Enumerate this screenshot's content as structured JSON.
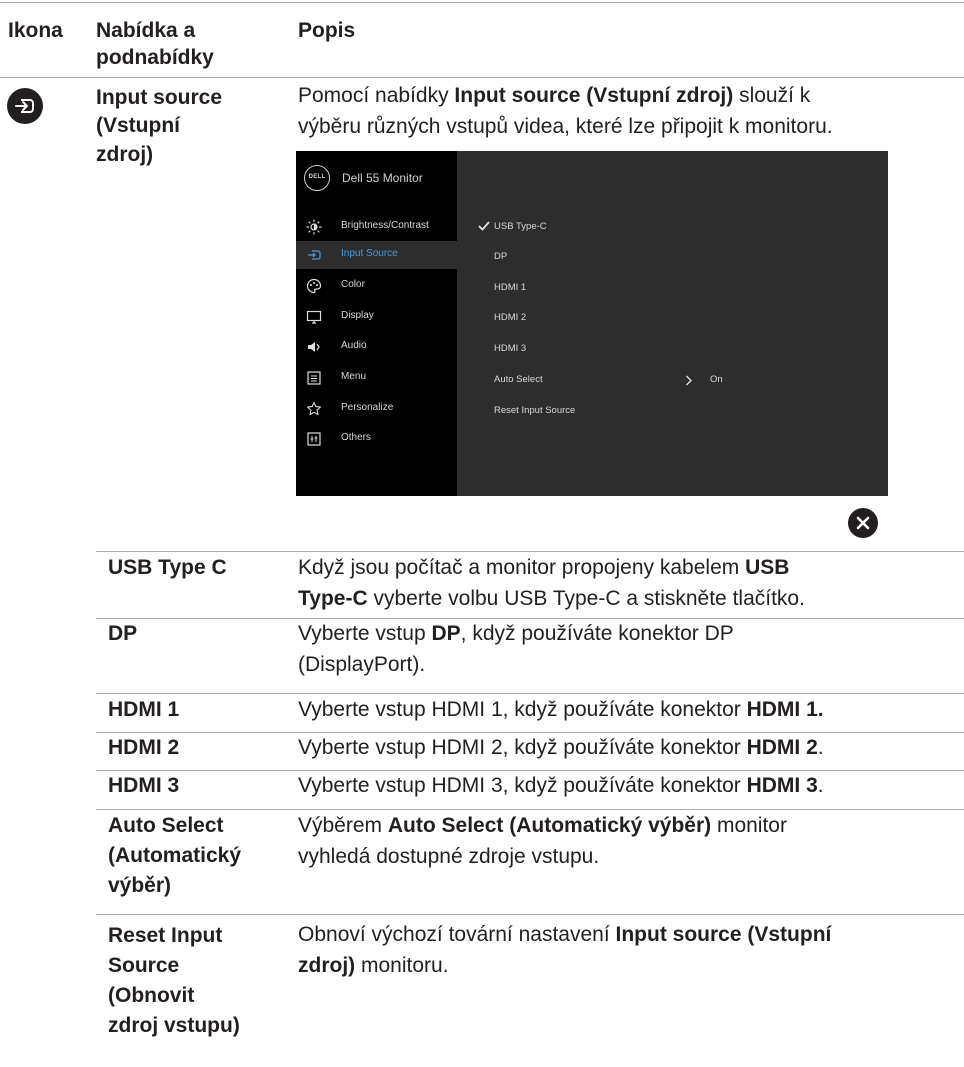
{
  "header": {
    "col_icon": "Ikona",
    "col_menu_line1": "Nabídka a",
    "col_menu_line2": "podnabídky",
    "col_desc": "Popis"
  },
  "main_row": {
    "icon": "input-source-icon",
    "label_lines": [
      "Input source",
      "(Vstupní",
      "zdroj)"
    ],
    "desc_line1_pre": "Pomocí nabídky ",
    "desc_line1_bold": "Input source (Vstupní zdroj)",
    "desc_line1_post": " slouží k",
    "desc_line2": "výběru různých vstupů videa, které lze připojit k monitoru."
  },
  "osd": {
    "logo_text": "DELL",
    "title": "Dell 55 Monitor",
    "menu": [
      {
        "label": "Brightness/Contrast",
        "icon": "brightness-icon"
      },
      {
        "label": "Input Source",
        "icon": "input-source-icon",
        "selected": true
      },
      {
        "label": "Color",
        "icon": "color-palette-icon"
      },
      {
        "label": "Display",
        "icon": "display-icon"
      },
      {
        "label": "Audio",
        "icon": "speaker-icon"
      },
      {
        "label": "Menu",
        "icon": "menu-icon"
      },
      {
        "label": "Personalize",
        "icon": "star-icon"
      },
      {
        "label": "Others",
        "icon": "others-icon"
      }
    ],
    "options": [
      {
        "label": "USB Type-C",
        "checked": true
      },
      {
        "label": "DP"
      },
      {
        "label": "HDMI 1"
      },
      {
        "label": "HDMI 2"
      },
      {
        "label": "HDMI 3"
      },
      {
        "label": "Auto Select",
        "value": "On"
      },
      {
        "label": "Reset Input Source"
      }
    ],
    "close_icon": "close-icon"
  },
  "rows": [
    {
      "label_lines": [
        "USB Type C"
      ],
      "desc": [
        [
          "Když jsou počítač a monitor propojeny kabelem ",
          {
            "b": "USB"
          }
        ],
        [
          {
            "b": "Type-C"
          },
          " vyberte volbu USB Type-C a stiskněte tlačítko."
        ]
      ]
    },
    {
      "label_lines": [
        "DP"
      ],
      "desc": [
        [
          "Vyberte vstup ",
          {
            "b": "DP"
          },
          ", když používáte konektor DP"
        ],
        [
          "(DisplayPort)."
        ]
      ]
    },
    {
      "label_lines": [
        "HDMI 1"
      ],
      "desc": [
        [
          "Vyberte vstup HDMI 1, když používáte konektor ",
          {
            "b": "HDMI 1."
          }
        ]
      ]
    },
    {
      "label_lines": [
        "HDMI 2"
      ],
      "desc": [
        [
          "Vyberte vstup HDMI 2, když používáte konektor ",
          {
            "b": "HDMI 2"
          },
          "."
        ]
      ]
    },
    {
      "label_lines": [
        "HDMI 3"
      ],
      "desc": [
        [
          "Vyberte vstup HDMI 3, když používáte konektor ",
          {
            "b": "HDMI 3"
          },
          "."
        ]
      ]
    },
    {
      "label_lines": [
        "Auto Select",
        "(Automatický",
        "výběr)"
      ],
      "desc": [
        [
          "Výběrem ",
          {
            "b": "Auto Select (Automatický výběr)"
          },
          " monitor"
        ],
        [
          "vyhledá dostupné zdroje vstupu."
        ]
      ]
    },
    {
      "label_lines": [
        "Reset Input",
        "Source",
        "(Obnovit",
        "zdroj vstupu)"
      ],
      "desc": [
        [
          "Obnoví výchozí tovární nastavení ",
          {
            "b": "Input source (Vstupní"
          }
        ],
        [
          {
            "b": "zdroj)"
          },
          " monitoru."
        ]
      ]
    }
  ]
}
